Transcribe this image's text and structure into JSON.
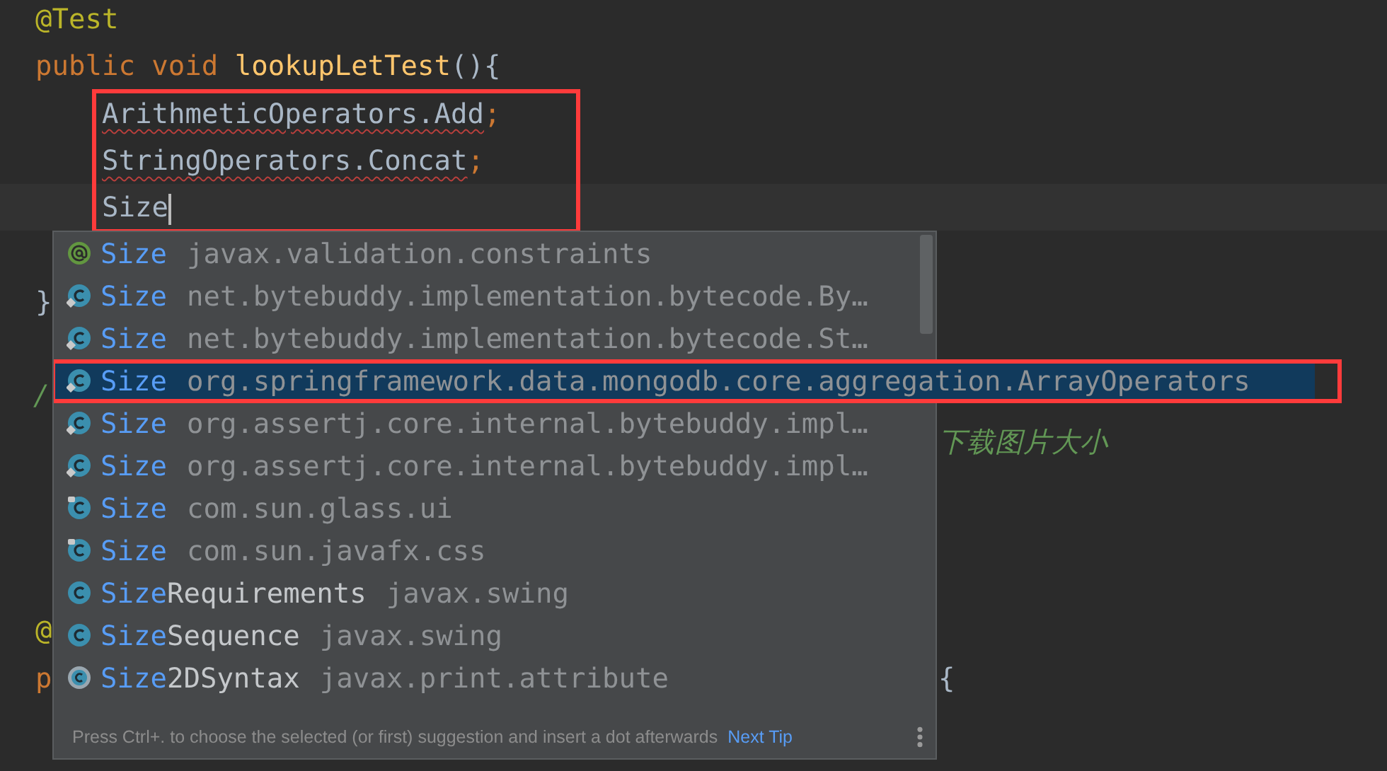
{
  "editor": {
    "lines": [
      {
        "kind": "code",
        "tokens": [
          {
            "text": "@Test",
            "kind": "annotation"
          }
        ]
      },
      {
        "kind": "code",
        "tokens": [
          {
            "text": "public void ",
            "kind": "keyword"
          },
          {
            "text": "lookupLetTest",
            "kind": "method"
          },
          {
            "text": "(){",
            "kind": "plain"
          }
        ]
      },
      {
        "kind": "code",
        "indented": true,
        "marked": true,
        "tokens": [
          {
            "text": "ArithmeticOperators.Add",
            "kind": "error"
          },
          {
            "text": ";",
            "kind": "punct"
          }
        ]
      },
      {
        "kind": "code",
        "indented": true,
        "marked": true,
        "tokens": [
          {
            "text": "StringOperators.Concat",
            "kind": "error"
          },
          {
            "text": ";",
            "kind": "punct"
          }
        ]
      },
      {
        "kind": "code",
        "indented": true,
        "marked": true,
        "current": true,
        "caret": true,
        "tokens": [
          {
            "text": "Size",
            "kind": "plain"
          }
        ]
      },
      {
        "kind": "blank"
      },
      {
        "kind": "code",
        "tokens": [
          {
            "text": "}",
            "kind": "plain"
          }
        ]
      },
      {
        "kind": "blank"
      },
      {
        "kind": "code",
        "tokens": [
          {
            "text": "/",
            "kind": "doc"
          }
        ]
      },
      {
        "kind": "code",
        "tokens": [
          {
            "text": "下载图片大小",
            "kind": "doc",
            "past_popup": true
          }
        ]
      },
      {
        "kind": "blank"
      },
      {
        "kind": "blank"
      },
      {
        "kind": "blank"
      },
      {
        "kind": "code",
        "tokens": [
          {
            "text": "@",
            "kind": "annotation"
          }
        ]
      },
      {
        "kind": "code",
        "tokens": [
          {
            "text": "p",
            "kind": "keyword"
          },
          {
            "text": "{",
            "kind": "plain",
            "past_popup": true
          }
        ]
      }
    ]
  },
  "completion": {
    "items": [
      {
        "kind": "annotation",
        "match": "Size",
        "package": "javax.validation.constraints",
        "selected": false
      },
      {
        "kind": "restricted",
        "match": "Size",
        "package": "net.bytebuddy.implementation.bytecode.By…",
        "selected": false
      },
      {
        "kind": "restricted",
        "match": "Size",
        "package": "net.bytebuddy.implementation.bytecode.St…",
        "selected": false
      },
      {
        "kind": "restricted",
        "match": "Size",
        "package": "org.springframework.data.mongodb.core.aggregation.ArrayOperators",
        "selected": true,
        "marked": true
      },
      {
        "kind": "restricted",
        "match": "Size",
        "package": "org.assertj.core.internal.bytebuddy.impl…",
        "selected": false
      },
      {
        "kind": "restricted",
        "match": "Size",
        "package": "org.assertj.core.internal.bytebuddy.impl…",
        "selected": false
      },
      {
        "kind": "internal",
        "match": "Size",
        "package": "com.sun.glass.ui",
        "selected": false
      },
      {
        "kind": "internal",
        "match": "Size",
        "package": "com.sun.javafx.css",
        "selected": false
      },
      {
        "kind": "class",
        "match": "Size",
        "rest": "Requirements",
        "package": "javax.swing",
        "selected": false
      },
      {
        "kind": "class",
        "match": "Size",
        "rest": "Sequence",
        "package": "javax.swing",
        "selected": false
      },
      {
        "kind": "abstract",
        "match": "Size",
        "rest": "2DSyntax",
        "package": "javax.print.attribute",
        "selected": false
      }
    ],
    "hint": "Press Ctrl+. to choose the selected (or first) suggestion and insert a dot afterwards",
    "link": "Next Tip"
  }
}
